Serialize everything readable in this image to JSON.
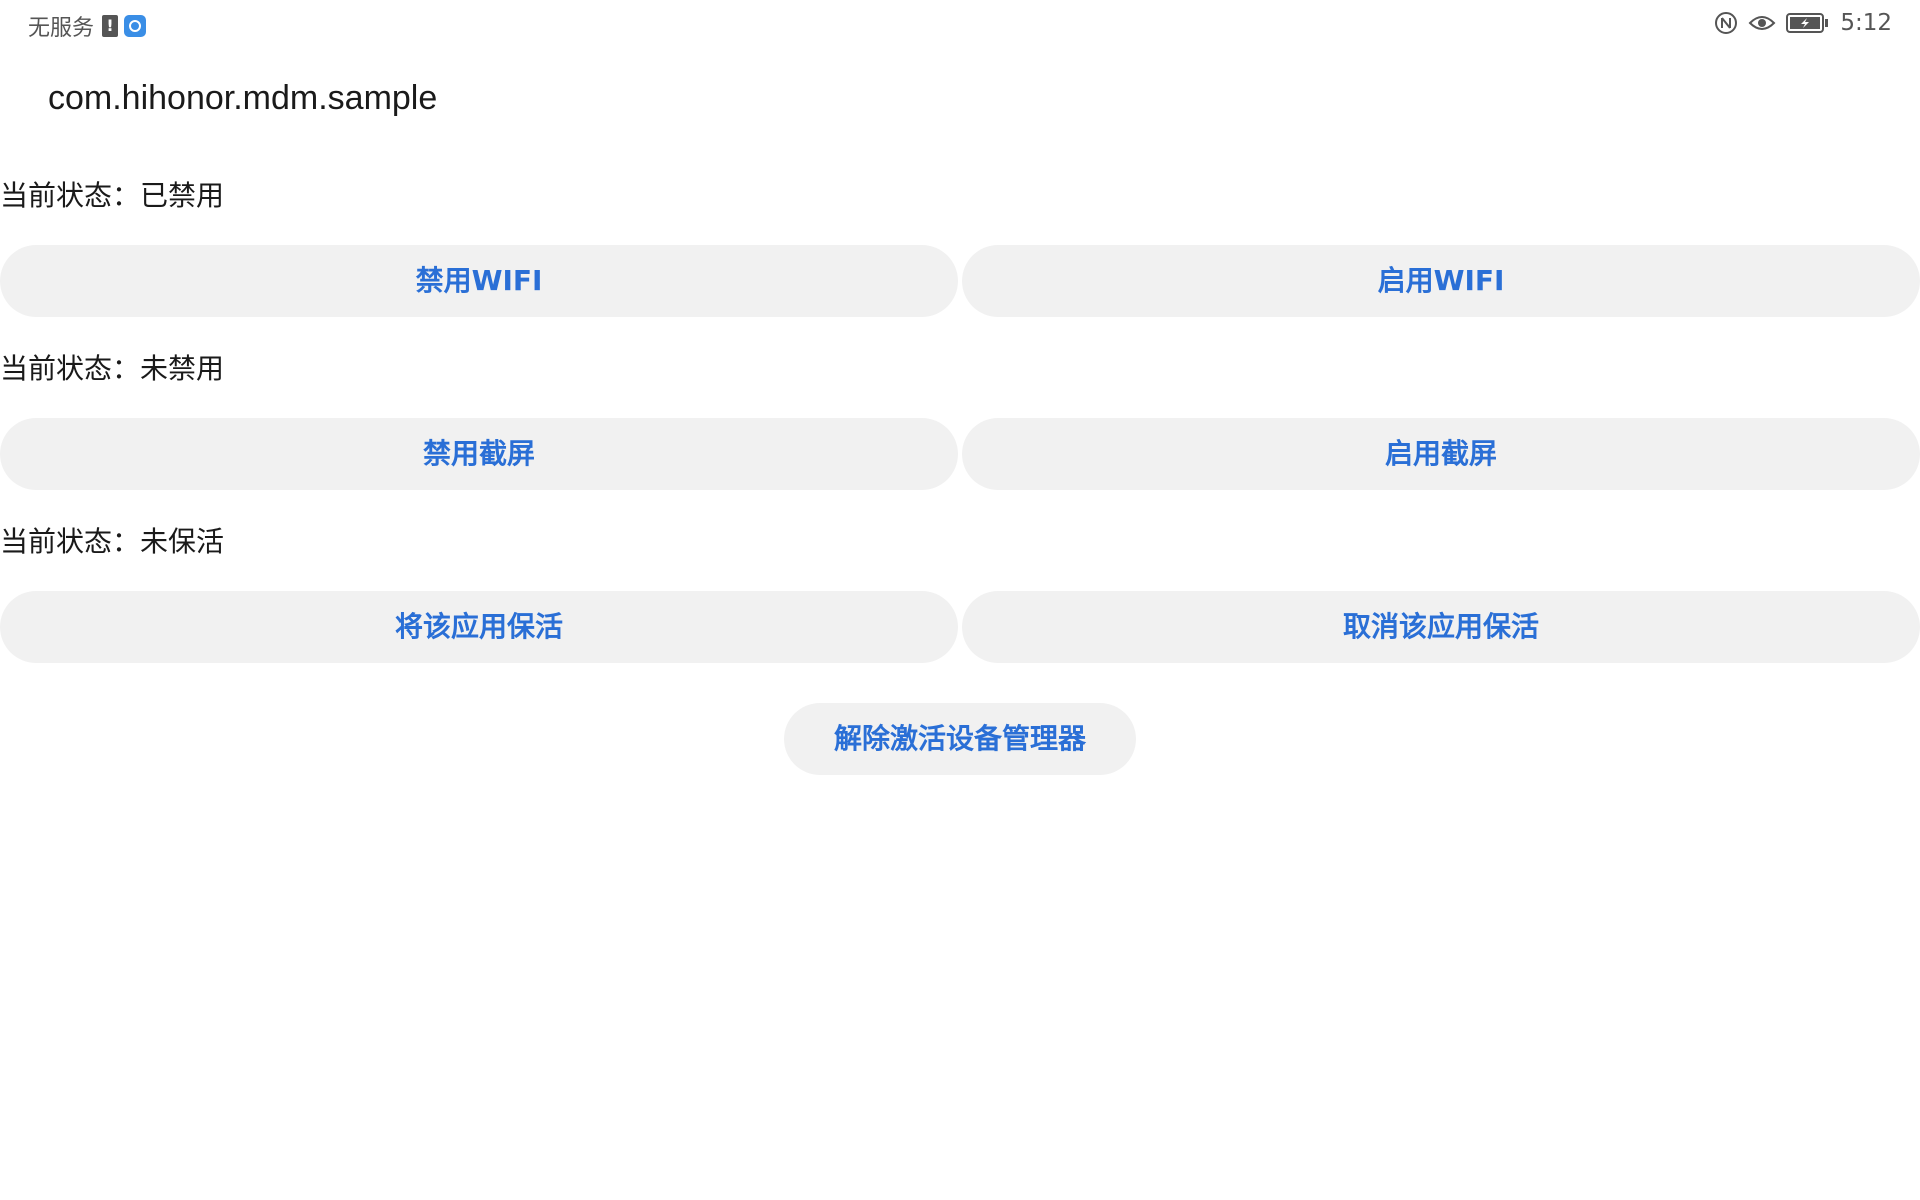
{
  "status_bar": {
    "carrier": "无服务",
    "time": "5:12",
    "icons": [
      "sim-alert-icon",
      "app-notification-icon",
      "nfc-icon",
      "eye-comfort-icon",
      "battery-charging-icon"
    ]
  },
  "app": {
    "title": "com.hihonor.mdm.sample"
  },
  "sections": [
    {
      "status": "当前状态：已禁用",
      "left_button": "禁用WIFI",
      "right_button": "启用WIFI"
    },
    {
      "status": "当前状态：未禁用",
      "left_button": "禁用截屏",
      "right_button": "启用截屏"
    },
    {
      "status": "当前状态：未保活",
      "left_button": "将该应用保活",
      "right_button": "取消该应用保活"
    }
  ],
  "deactivate_button": "解除激活设备管理器",
  "colors": {
    "button_background": "#f1f1f1",
    "button_text": "#2a6fd6",
    "text": "#1a1a1a",
    "status_bar_text": "#555555"
  }
}
